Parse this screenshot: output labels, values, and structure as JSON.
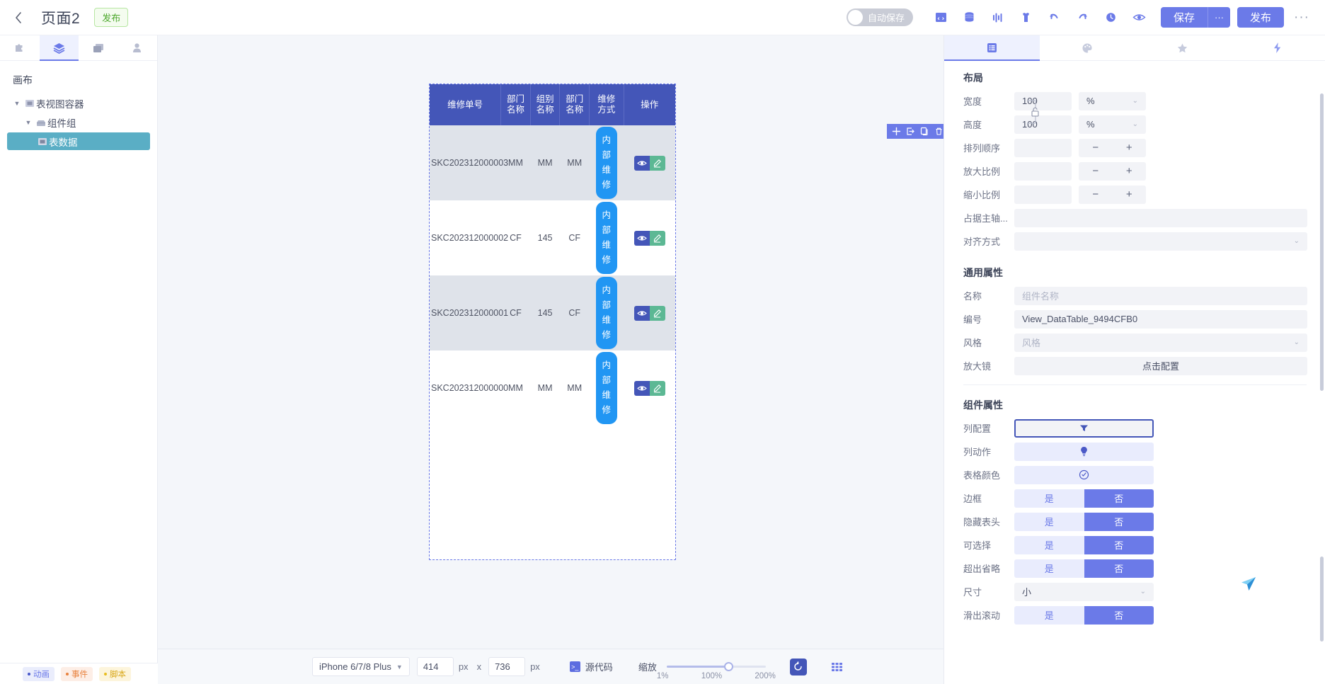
{
  "header": {
    "back_icon": "chevron-left-icon",
    "title": "页面2",
    "publish_badge": "发布",
    "autosave_label": "自动保存",
    "tool_icons": [
      "code-snippet-icon",
      "database-icon",
      "chart-bars-icon",
      "trash-shirt-icon",
      "undo-icon",
      "redo-icon",
      "history-clock-icon",
      "preview-eye-icon"
    ],
    "save_label": "保存",
    "save_more": "···",
    "publish_label": "发布",
    "overflow": "···"
  },
  "left_panel": {
    "tabs": [
      {
        "name": "puzzle-icon",
        "active": false
      },
      {
        "name": "layers-icon",
        "active": true
      },
      {
        "name": "images-icon",
        "active": false
      },
      {
        "name": "user-icon",
        "active": false
      }
    ],
    "title": "画布",
    "tree": [
      {
        "label": "表视图容器",
        "level": 1,
        "caret": "▼",
        "icon": "container-icon",
        "selected": false
      },
      {
        "label": "组件组",
        "level": 2,
        "caret": "▼",
        "icon": "group-icon",
        "selected": false
      },
      {
        "label": "表数据",
        "level": 3,
        "caret": "",
        "icon": "table-icon",
        "selected": true
      }
    ],
    "footer_chips": [
      {
        "label": "动画",
        "type": "anim"
      },
      {
        "label": "事件",
        "type": "evt"
      },
      {
        "label": "脚本",
        "type": "scr"
      }
    ]
  },
  "canvas": {
    "selection_toolbar": [
      "add-icon",
      "insert-icon",
      "copy-icon",
      "delete-icon",
      "more-icon"
    ],
    "table": {
      "columns": [
        "维修单号",
        "部门\n名称",
        "组别\n名称",
        "部门\n名称",
        "维修\n方式",
        "操作"
      ],
      "columns_flat": [
        "维修单号",
        "部门名称",
        "组别名称",
        "部门名称",
        "维修方式",
        "操作"
      ],
      "rows": [
        {
          "order_no": "SKC202312000003",
          "dept_name": "MM",
          "group_name": "MM",
          "dept_name2": "MM",
          "repair_way": "内部维修",
          "actions": [
            "view-eye-icon",
            "edit-pen-icon"
          ]
        },
        {
          "order_no": "SKC202312000002",
          "dept_name": "CF",
          "group_name": "145",
          "dept_name2": "CF",
          "repair_way": "内部维修",
          "actions": [
            "view-eye-icon",
            "edit-pen-icon"
          ]
        },
        {
          "order_no": "SKC202312000001",
          "dept_name": "CF",
          "group_name": "145",
          "dept_name2": "CF",
          "repair_way": "内部维修",
          "actions": [
            "view-eye-icon",
            "edit-pen-icon"
          ]
        },
        {
          "order_no": "SKC202312000000",
          "dept_name": "MM",
          "group_name": "MM",
          "dept_name2": "MM",
          "repair_way": "内部维修",
          "actions": [
            "view-eye-icon",
            "edit-pen-icon"
          ]
        }
      ]
    }
  },
  "bottom_bar": {
    "device": "iPhone 6/7/8 Plus",
    "width": "414",
    "width_unit": "px",
    "x": "x",
    "height": "736",
    "height_unit": "px",
    "source_code_label": "源代码",
    "zoom_label": "缩放",
    "zoom_min": "1%",
    "zoom_mid": "100%",
    "zoom_max": "200%",
    "reset_icon": "refresh-icon",
    "grid_icon": "grid-icon"
  },
  "right_panel": {
    "tabs": [
      {
        "name": "properties-list-icon",
        "active": true
      },
      {
        "name": "palette-icon",
        "active": false
      },
      {
        "name": "star-icon",
        "active": false
      },
      {
        "name": "lightning-icon",
        "active": false
      }
    ],
    "layout": {
      "title": "布局",
      "width_label": "宽度",
      "width_value": "100",
      "width_unit": "%",
      "height_label": "高度",
      "height_value": "100",
      "height_unit": "%",
      "order_label": "排列顺序",
      "order_value": "",
      "grow_label": "放大比例",
      "grow_value": "",
      "shrink_label": "缩小比例",
      "shrink_value": "",
      "basis_label": "占据主轴...",
      "basis_value": "",
      "align_label": "对齐方式",
      "align_value": ""
    },
    "common": {
      "title": "通用属性",
      "name_label": "名称",
      "name_placeholder": "组件名称",
      "id_label": "编号",
      "id_value": "View_DataTable_9494CFB0",
      "style_label": "风格",
      "style_placeholder": "风格",
      "magnifier_label": "放大镜",
      "magnifier_button": "点击配置"
    },
    "component": {
      "title": "组件属性",
      "column_config_label": "列配置",
      "column_config_icon": "filter-icon",
      "column_action_label": "列动作",
      "column_action_icon": "bulb-icon",
      "table_color_label": "表格颜色",
      "table_color_icon": "gauge-icon",
      "toggles": [
        {
          "label": "边框",
          "yes": "是",
          "no": "否",
          "selected": "否"
        },
        {
          "label": "隐藏表头",
          "yes": "是",
          "no": "否",
          "selected": "否"
        },
        {
          "label": "可选择",
          "yes": "是",
          "no": "否",
          "selected": "否"
        },
        {
          "label": "超出省略",
          "yes": "是",
          "no": "否",
          "selected": "否"
        }
      ],
      "size_label": "尺寸",
      "size_value": "小",
      "scroll_label": "滑出滚动",
      "scroll_yes": "是",
      "scroll_no": "否"
    }
  },
  "colors": {
    "accent": "#6b7ae8",
    "table_header": "#4456b8",
    "badge_blue": "#2196f3",
    "edit_green": "#5cb894",
    "selected_tree": "#5aaec5"
  }
}
